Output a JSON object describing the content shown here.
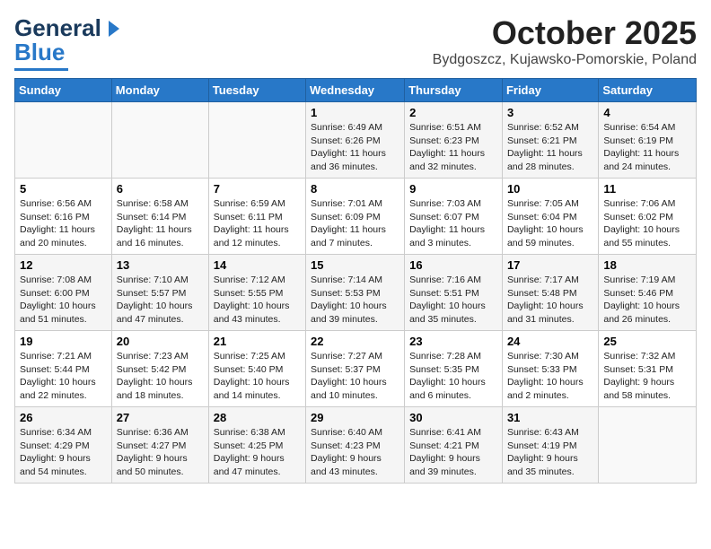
{
  "header": {
    "logo_line1": "General",
    "logo_line2": "Blue",
    "month": "October 2025",
    "location": "Bydgoszcz, Kujawsko-Pomorskie, Poland"
  },
  "days_of_week": [
    "Sunday",
    "Monday",
    "Tuesday",
    "Wednesday",
    "Thursday",
    "Friday",
    "Saturday"
  ],
  "weeks": [
    [
      {
        "num": "",
        "info": ""
      },
      {
        "num": "",
        "info": ""
      },
      {
        "num": "",
        "info": ""
      },
      {
        "num": "1",
        "info": "Sunrise: 6:49 AM\nSunset: 6:26 PM\nDaylight: 11 hours\nand 36 minutes."
      },
      {
        "num": "2",
        "info": "Sunrise: 6:51 AM\nSunset: 6:23 PM\nDaylight: 11 hours\nand 32 minutes."
      },
      {
        "num": "3",
        "info": "Sunrise: 6:52 AM\nSunset: 6:21 PM\nDaylight: 11 hours\nand 28 minutes."
      },
      {
        "num": "4",
        "info": "Sunrise: 6:54 AM\nSunset: 6:19 PM\nDaylight: 11 hours\nand 24 minutes."
      }
    ],
    [
      {
        "num": "5",
        "info": "Sunrise: 6:56 AM\nSunset: 6:16 PM\nDaylight: 11 hours\nand 20 minutes."
      },
      {
        "num": "6",
        "info": "Sunrise: 6:58 AM\nSunset: 6:14 PM\nDaylight: 11 hours\nand 16 minutes."
      },
      {
        "num": "7",
        "info": "Sunrise: 6:59 AM\nSunset: 6:11 PM\nDaylight: 11 hours\nand 12 minutes."
      },
      {
        "num": "8",
        "info": "Sunrise: 7:01 AM\nSunset: 6:09 PM\nDaylight: 11 hours\nand 7 minutes."
      },
      {
        "num": "9",
        "info": "Sunrise: 7:03 AM\nSunset: 6:07 PM\nDaylight: 11 hours\nand 3 minutes."
      },
      {
        "num": "10",
        "info": "Sunrise: 7:05 AM\nSunset: 6:04 PM\nDaylight: 10 hours\nand 59 minutes."
      },
      {
        "num": "11",
        "info": "Sunrise: 7:06 AM\nSunset: 6:02 PM\nDaylight: 10 hours\nand 55 minutes."
      }
    ],
    [
      {
        "num": "12",
        "info": "Sunrise: 7:08 AM\nSunset: 6:00 PM\nDaylight: 10 hours\nand 51 minutes."
      },
      {
        "num": "13",
        "info": "Sunrise: 7:10 AM\nSunset: 5:57 PM\nDaylight: 10 hours\nand 47 minutes."
      },
      {
        "num": "14",
        "info": "Sunrise: 7:12 AM\nSunset: 5:55 PM\nDaylight: 10 hours\nand 43 minutes."
      },
      {
        "num": "15",
        "info": "Sunrise: 7:14 AM\nSunset: 5:53 PM\nDaylight: 10 hours\nand 39 minutes."
      },
      {
        "num": "16",
        "info": "Sunrise: 7:16 AM\nSunset: 5:51 PM\nDaylight: 10 hours\nand 35 minutes."
      },
      {
        "num": "17",
        "info": "Sunrise: 7:17 AM\nSunset: 5:48 PM\nDaylight: 10 hours\nand 31 minutes."
      },
      {
        "num": "18",
        "info": "Sunrise: 7:19 AM\nSunset: 5:46 PM\nDaylight: 10 hours\nand 26 minutes."
      }
    ],
    [
      {
        "num": "19",
        "info": "Sunrise: 7:21 AM\nSunset: 5:44 PM\nDaylight: 10 hours\nand 22 minutes."
      },
      {
        "num": "20",
        "info": "Sunrise: 7:23 AM\nSunset: 5:42 PM\nDaylight: 10 hours\nand 18 minutes."
      },
      {
        "num": "21",
        "info": "Sunrise: 7:25 AM\nSunset: 5:40 PM\nDaylight: 10 hours\nand 14 minutes."
      },
      {
        "num": "22",
        "info": "Sunrise: 7:27 AM\nSunset: 5:37 PM\nDaylight: 10 hours\nand 10 minutes."
      },
      {
        "num": "23",
        "info": "Sunrise: 7:28 AM\nSunset: 5:35 PM\nDaylight: 10 hours\nand 6 minutes."
      },
      {
        "num": "24",
        "info": "Sunrise: 7:30 AM\nSunset: 5:33 PM\nDaylight: 10 hours\nand 2 minutes."
      },
      {
        "num": "25",
        "info": "Sunrise: 7:32 AM\nSunset: 5:31 PM\nDaylight: 9 hours\nand 58 minutes."
      }
    ],
    [
      {
        "num": "26",
        "info": "Sunrise: 6:34 AM\nSunset: 4:29 PM\nDaylight: 9 hours\nand 54 minutes."
      },
      {
        "num": "27",
        "info": "Sunrise: 6:36 AM\nSunset: 4:27 PM\nDaylight: 9 hours\nand 50 minutes."
      },
      {
        "num": "28",
        "info": "Sunrise: 6:38 AM\nSunset: 4:25 PM\nDaylight: 9 hours\nand 47 minutes."
      },
      {
        "num": "29",
        "info": "Sunrise: 6:40 AM\nSunset: 4:23 PM\nDaylight: 9 hours\nand 43 minutes."
      },
      {
        "num": "30",
        "info": "Sunrise: 6:41 AM\nSunset: 4:21 PM\nDaylight: 9 hours\nand 39 minutes."
      },
      {
        "num": "31",
        "info": "Sunrise: 6:43 AM\nSunset: 4:19 PM\nDaylight: 9 hours\nand 35 minutes."
      },
      {
        "num": "",
        "info": ""
      }
    ]
  ]
}
